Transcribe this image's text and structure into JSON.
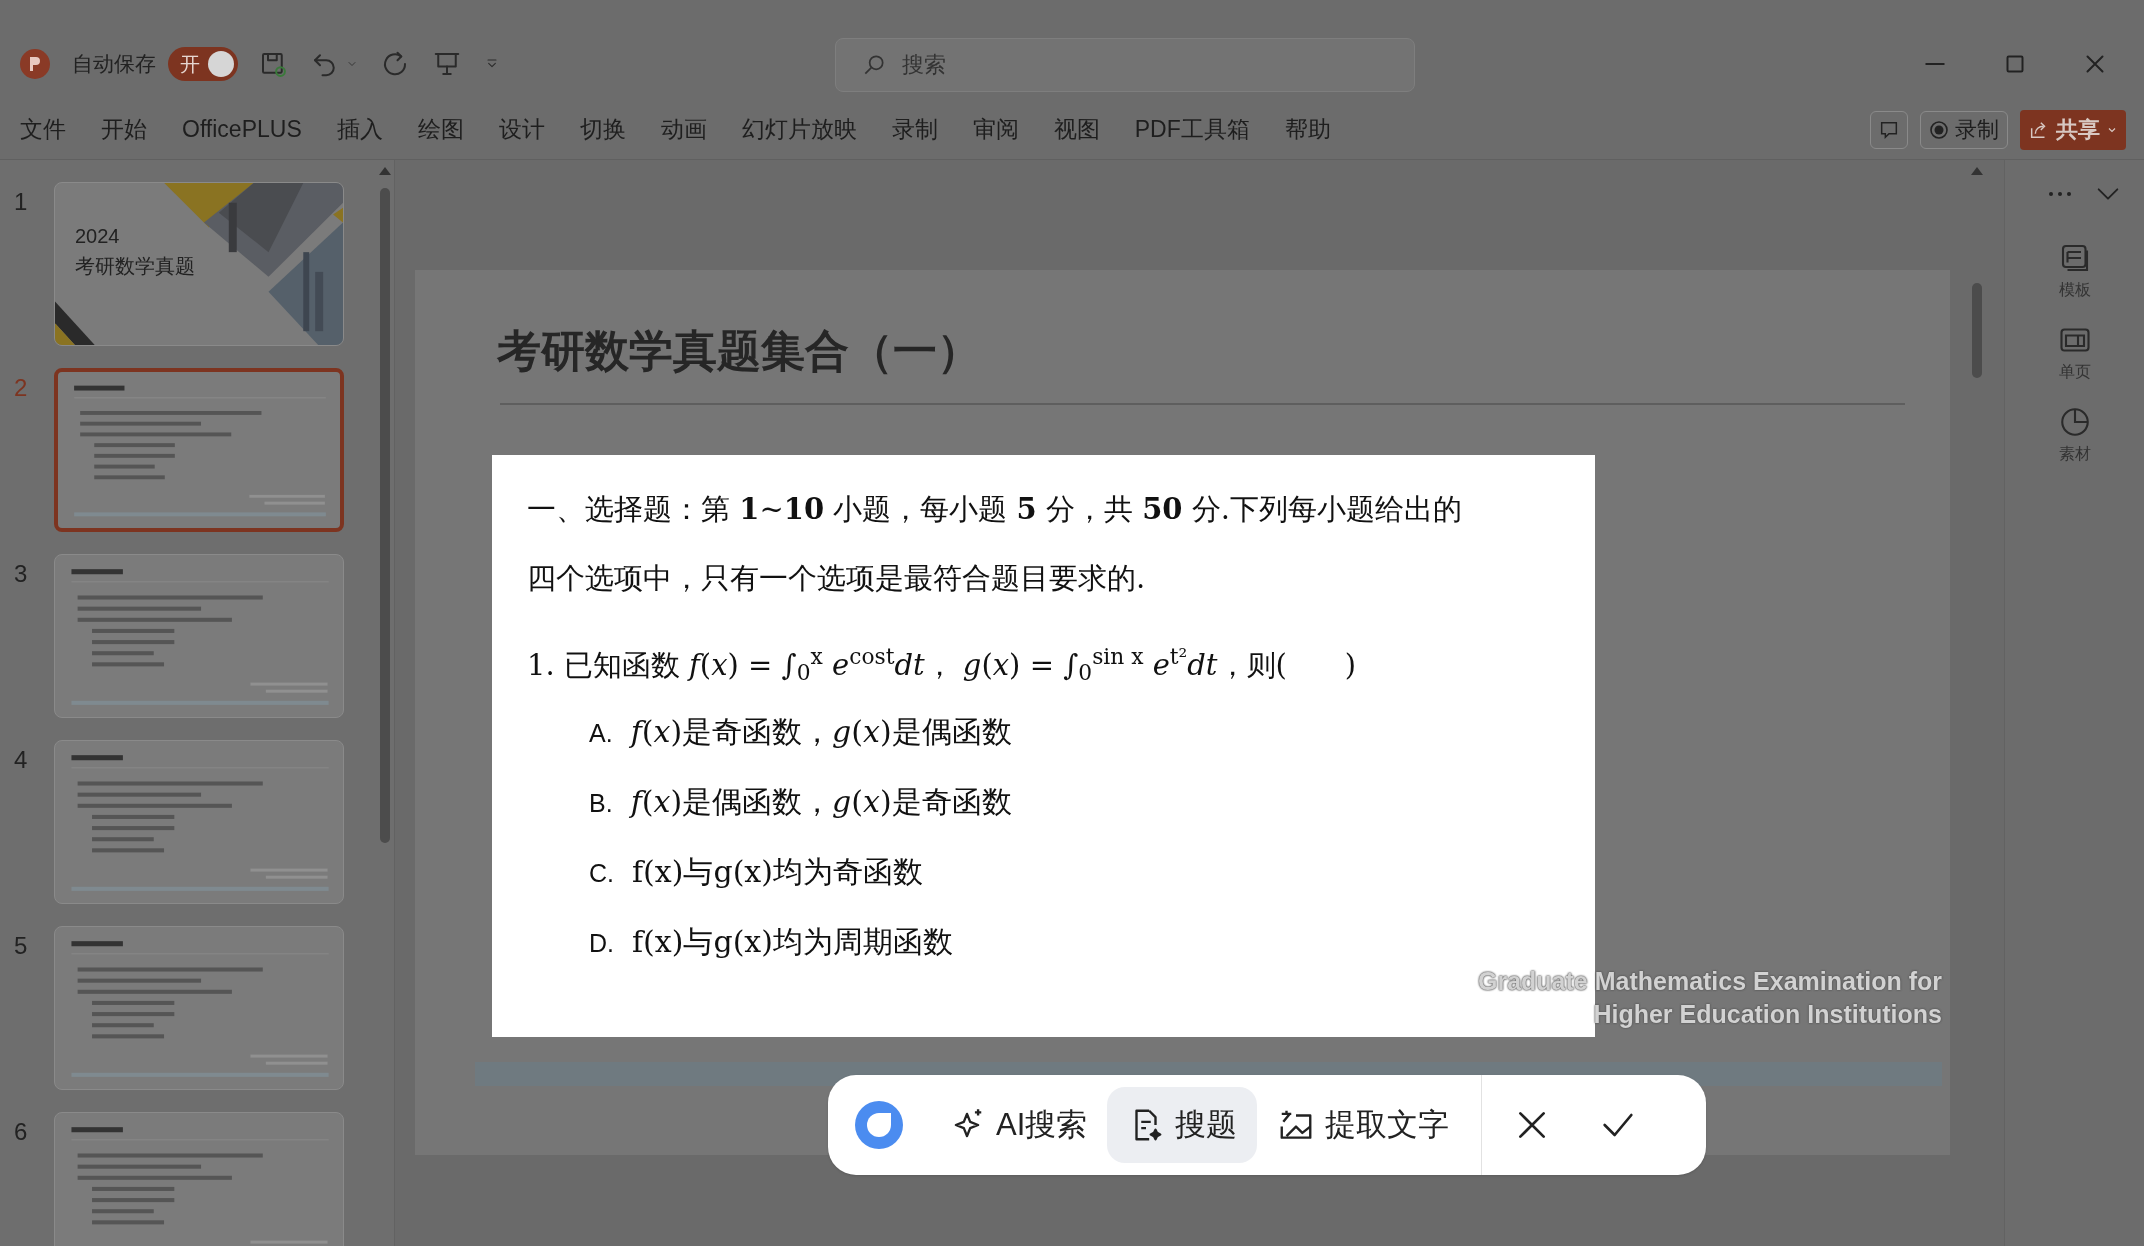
{
  "title_bar": {
    "autosave_label": "自动保存",
    "autosave_toggle": {
      "label": "开",
      "on": true
    },
    "search_placeholder": "搜索"
  },
  "menu": [
    "文件",
    "开始",
    "OfficePLUS",
    "插入",
    "绘图",
    "设计",
    "切换",
    "动画",
    "幻灯片放映",
    "录制",
    "审阅",
    "视图",
    "PDF工具箱",
    "帮助"
  ],
  "ribbon_buttons": {
    "record": "录制",
    "share": "共享"
  },
  "slides": [
    {
      "number": "1",
      "kind": "title",
      "lines": [
        "2024",
        "考研数学真题"
      ],
      "selected": false
    },
    {
      "number": "2",
      "kind": "content",
      "selected": true
    },
    {
      "number": "3",
      "kind": "content",
      "selected": false
    },
    {
      "number": "4",
      "kind": "content",
      "selected": false
    },
    {
      "number": "5",
      "kind": "content",
      "selected": false
    },
    {
      "number": "6",
      "kind": "content",
      "selected": false
    }
  ],
  "slide": {
    "title": "考研数学真题集合（一）",
    "footer_lines": [
      "Graduate Mathematics Examination for",
      "Higher Education Institutions"
    ]
  },
  "selection": {
    "intro": "一、选择题：第 **1**~**10** 小题，每小题 **5** 分，共 **50** 分.下列每小题给出的四个选项中，只有一个选项是最符合题目要求的.",
    "question": "1.  已知函数 *f*(*x*) = ∫$_{0}$$^{x}$ *e*$^{cost}$*dt*，  *g*(*x*) = ∫$_{0}$$^{sin x}$ *e*$^{t²}$*dt*，则(　　)",
    "options": [
      {
        "letter": "A.",
        "text": "*f*(*x*)是奇函数，*g*(*x*)是偶函数"
      },
      {
        "letter": "B.",
        "text": "*f*(*x*)是偶函数，*g*(*x*)是奇函数"
      },
      {
        "letter": "C.",
        "text": "f(x)与g(x)均为奇函数"
      },
      {
        "letter": "D.",
        "text": "f(x)与g(x)均为周期函数"
      }
    ]
  },
  "capture_toolbar": {
    "tools": [
      {
        "kind": "ai",
        "label": "AI搜索",
        "selected": false
      },
      {
        "kind": "question",
        "label": "搜题",
        "selected": true
      },
      {
        "kind": "ocr",
        "label": "提取文字",
        "selected": false
      }
    ]
  },
  "side_panel": [
    "模板",
    "单页",
    "素材"
  ]
}
